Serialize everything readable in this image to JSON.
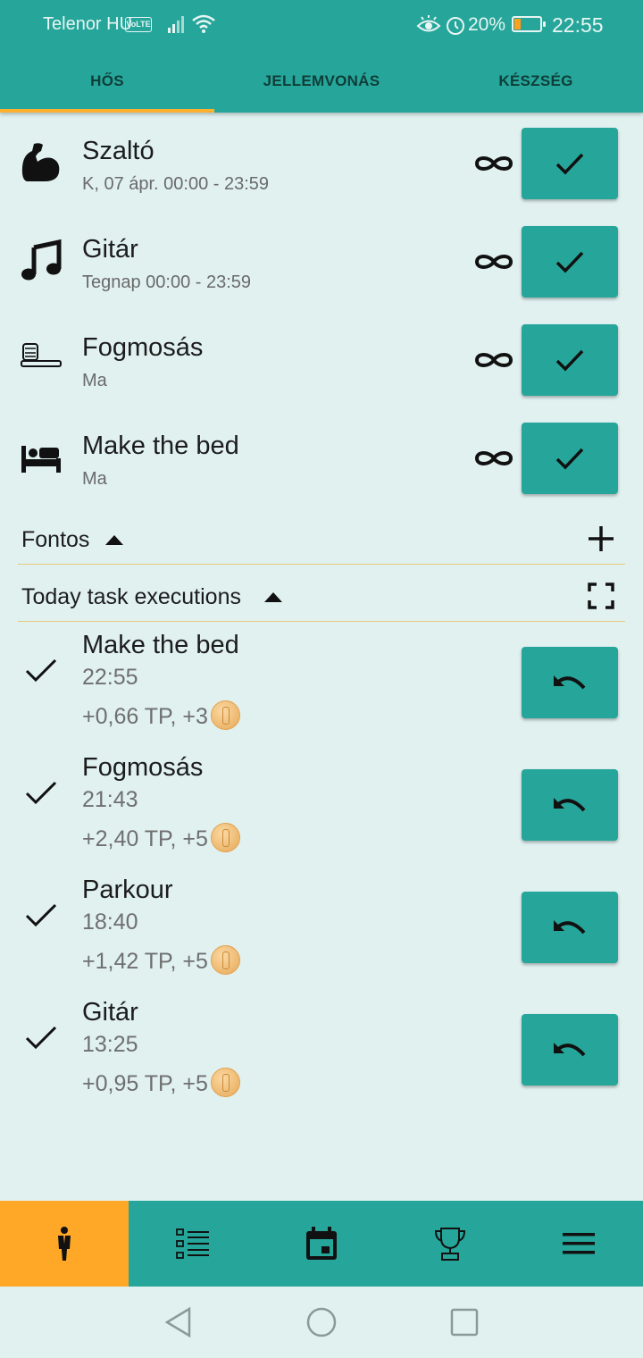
{
  "status_bar": {
    "carrier": "Telenor HU",
    "volte": "VoLTE",
    "battery_percent": "20%",
    "time": "22:55"
  },
  "tabs": [
    {
      "label": "HŐS",
      "active": true
    },
    {
      "label": "JELLEMVONÁS",
      "active": false
    },
    {
      "label": "KÉSZSÉG",
      "active": false
    }
  ],
  "habits": [
    {
      "title": "Szaltó",
      "subtitle": "K, 07 ápr. 00:00 - 23:59",
      "icon": "flexed-bicep-icon"
    },
    {
      "title": "Gitár",
      "subtitle": "Tegnap 00:00 - 23:59",
      "icon": "music-note-icon"
    },
    {
      "title": "Fogmosás",
      "subtitle": "Ma",
      "icon": "toothbrush-icon"
    },
    {
      "title": "Make the bed",
      "subtitle": "Ma",
      "icon": "bed-icon"
    }
  ],
  "sections": {
    "important": {
      "label": "Fontos"
    },
    "today": {
      "label": "Today task executions"
    }
  },
  "executions": [
    {
      "title": "Make the bed",
      "time": "22:55",
      "reward": "+0,66 TP, +3"
    },
    {
      "title": "Fogmosás",
      "time": "21:43",
      "reward": "+2,40 TP, +5"
    },
    {
      "title": "Parkour",
      "time": "18:40",
      "reward": "+1,42 TP, +5"
    },
    {
      "title": "Gitár",
      "time": "13:25",
      "reward": "+0,95 TP, +5"
    }
  ],
  "bottom_nav": [
    {
      "icon": "hero-person-icon",
      "active": true
    },
    {
      "icon": "checklist-icon",
      "active": false
    },
    {
      "icon": "calendar-icon",
      "active": false
    },
    {
      "icon": "trophy-icon",
      "active": false
    },
    {
      "icon": "menu-icon",
      "active": false
    }
  ],
  "colors": {
    "primary": "#26a69a",
    "accent": "#ffa726",
    "background": "#e0f1f0"
  }
}
